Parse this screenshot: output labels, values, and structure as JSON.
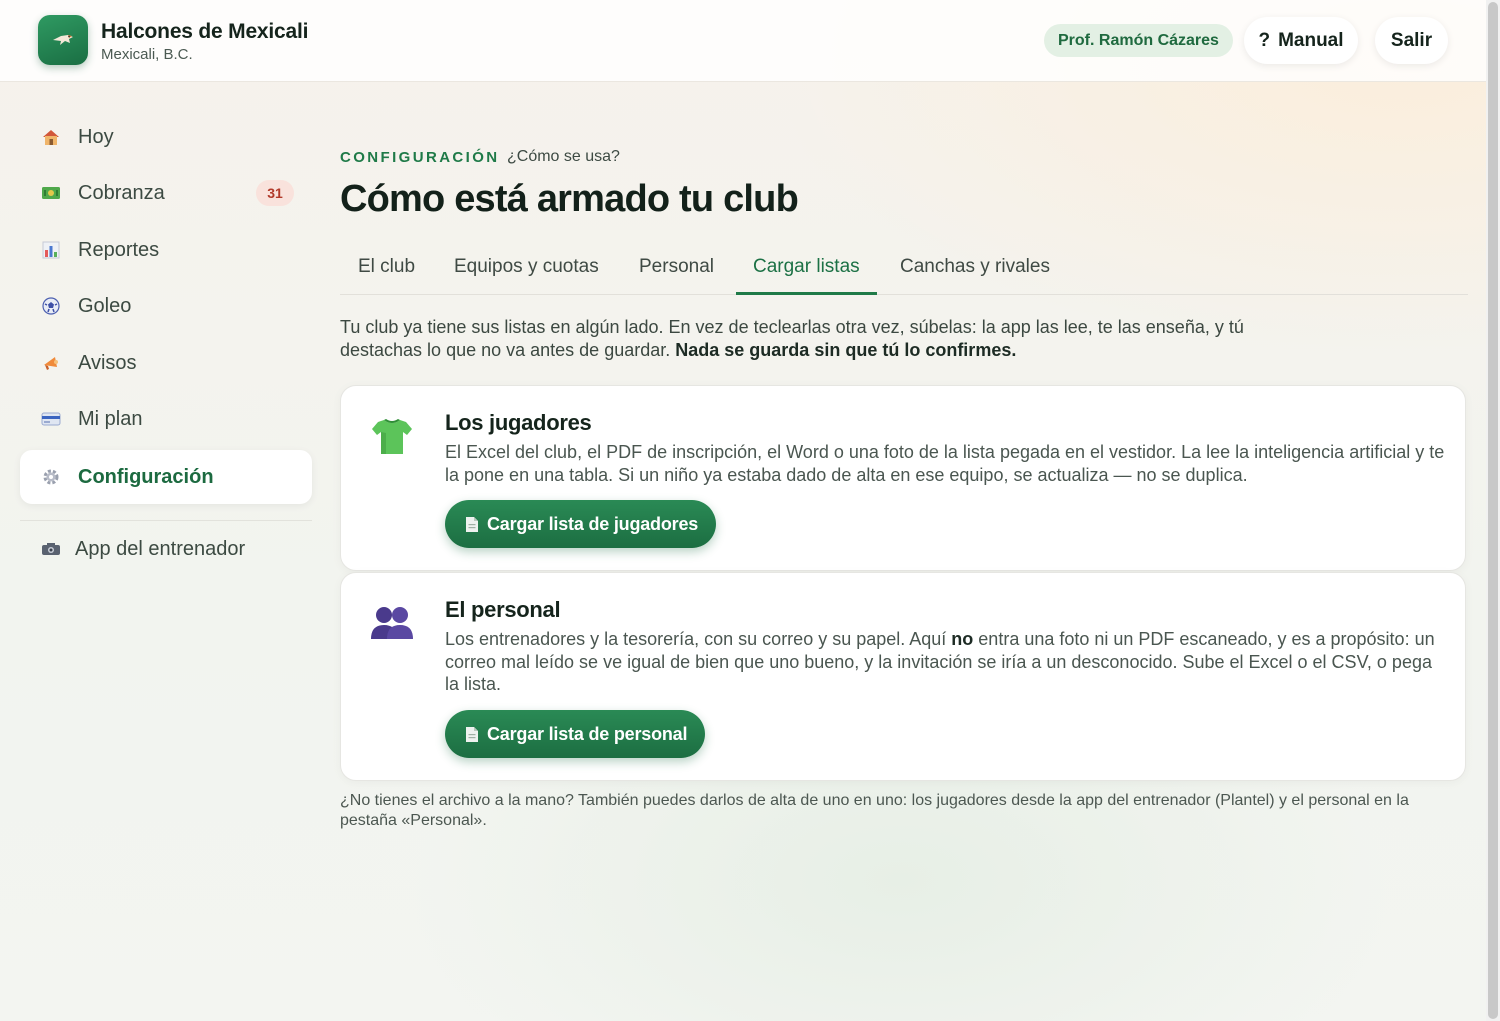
{
  "header": {
    "club_name": "Halcones de Mexicali",
    "club_city": "Mexicali, B.C.",
    "user": "Prof. Ramón Cázares",
    "manual_icon": "?",
    "manual_label": "Manual",
    "logout_label": "Salir"
  },
  "sidebar": {
    "items": [
      {
        "label": "Hoy",
        "icon": "house-icon"
      },
      {
        "label": "Cobranza",
        "icon": "money-icon",
        "badge": "31"
      },
      {
        "label": "Reportes",
        "icon": "bar-chart-icon"
      },
      {
        "label": "Goleo",
        "icon": "soccer-ball-icon"
      },
      {
        "label": "Avisos",
        "icon": "megaphone-icon"
      },
      {
        "label": "Mi plan",
        "icon": "credit-card-icon"
      },
      {
        "label": "Configuración",
        "icon": "gear-icon",
        "active": true
      }
    ],
    "secondary": {
      "label": "App del entrenador",
      "icon": "camera-icon"
    }
  },
  "main": {
    "section_label": "CONFIGURACIÓN",
    "help_link": "¿Cómo se usa?",
    "title": "Cómo está armado tu club",
    "tabs": [
      {
        "label": "El club"
      },
      {
        "label": "Equipos y cuotas"
      },
      {
        "label": "Personal"
      },
      {
        "label": "Cargar listas",
        "active": true
      },
      {
        "label": "Canchas y rivales"
      }
    ],
    "intro_text": "Tu club ya tiene sus listas en algún lado. En vez de teclearlas otra vez, súbelas: la app las lee, te las enseña, y tú destachas lo que no va antes de guardar.",
    "intro_bold": "Nada se guarda sin que tú lo confirmes.",
    "cards": [
      {
        "icon": "shirt-icon",
        "title": "Los jugadores",
        "text": "El Excel del club, el PDF de inscripción, el Word o una foto de la lista pegada en el vestidor. La lee la inteligencia artificial y te la pone en una tabla. Si un niño ya estaba dado de alta en ese equipo, se actualiza — no se duplica.",
        "button": "Cargar lista de jugadores"
      },
      {
        "icon": "people-icon",
        "title": "El personal",
        "text_before": "Los entrenadores y la tesorería, con su correo y su papel. Aquí ",
        "text_bold": "no",
        "text_after": " entra una foto ni un PDF escaneado, y es a propósito: un correo mal leído se ve igual de bien que uno bueno, y la invitación se iría a un desconocido. Sube el Excel o el CSV, o pega la lista.",
        "button": "Cargar lista de personal"
      }
    ],
    "footnote": "¿No tienes el archivo a la mano? También puedes darlos de alta de uno en uno: los jugadores desde la app del entrenador (Plantel) y el personal en la pestaña «Personal»."
  },
  "colors": {
    "brand_green": "#1f7a48",
    "badge_bg": "#f9e2dc",
    "badge_text": "#b23a2a",
    "user_chip_bg": "#e3f0e4"
  }
}
